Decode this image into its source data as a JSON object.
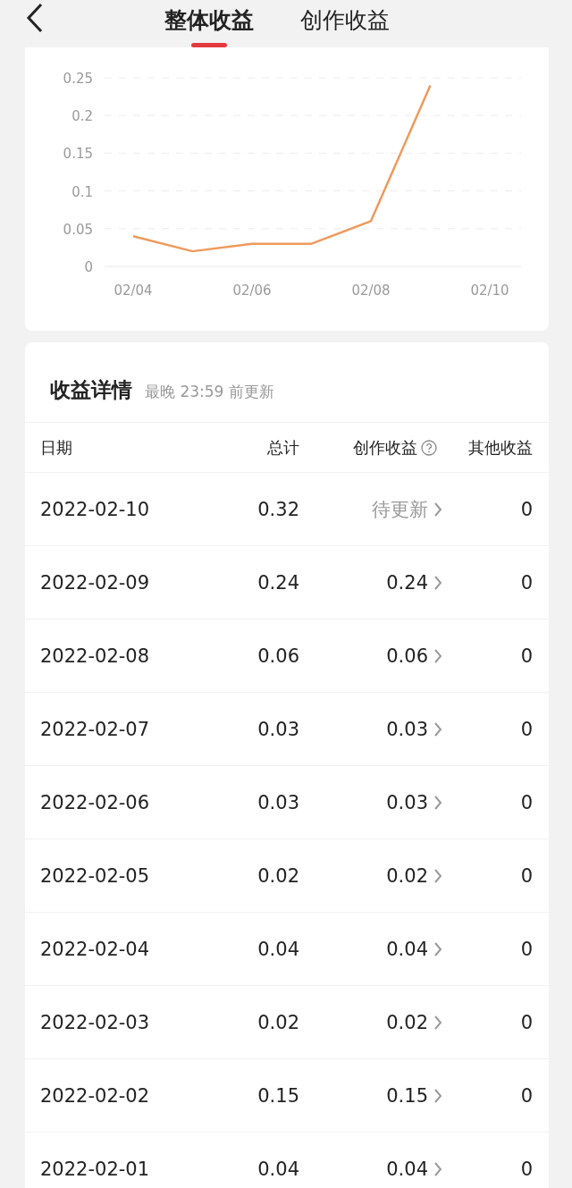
{
  "tabs": [
    {
      "label": "整体收益",
      "selected": true
    },
    {
      "label": "创作收益",
      "selected": false
    }
  ],
  "trend": {
    "chart_data": {
      "type": "line",
      "grid": true,
      "ylim": [
        0,
        0.25
      ],
      "categories": [
        "02/04",
        null,
        "02/06",
        null,
        "02/08",
        null,
        "02/10"
      ],
      "series": [
        {
          "color": "#ee9a5c",
          "values": [
            0.04,
            0.02,
            0.03,
            0.03,
            0.06,
            0.24,
            null
          ]
        }
      ],
      "yticks": [
        {
          "value": 0,
          "label": "0"
        },
        {
          "value": 0.05,
          "label": "0.05"
        },
        {
          "value": 0.1,
          "label": "0.1"
        },
        {
          "value": 0.15,
          "label": "0.15"
        },
        {
          "value": 0.2,
          "label": "0.2"
        },
        {
          "value": 0.25,
          "label": "0.25"
        }
      ]
    }
  },
  "details": {
    "title": "收益详情",
    "note": "最晚 23:59 前更新",
    "columns": [
      "日期",
      "总计",
      "创作收益",
      "其他收益"
    ],
    "rows": [
      {
        "date": "2022-02-10",
        "total": "0.32",
        "creation": "待更新",
        "pending": true,
        "other": "0"
      },
      {
        "date": "2022-02-09",
        "total": "0.24",
        "creation": "0.24",
        "pending": false,
        "other": "0"
      },
      {
        "date": "2022-02-08",
        "total": "0.06",
        "creation": "0.06",
        "pending": false,
        "other": "0"
      },
      {
        "date": "2022-02-07",
        "total": "0.03",
        "creation": "0.03",
        "pending": false,
        "other": "0"
      },
      {
        "date": "2022-02-06",
        "total": "0.03",
        "creation": "0.03",
        "pending": false,
        "other": "0"
      },
      {
        "date": "2022-02-05",
        "total": "0.02",
        "creation": "0.02",
        "pending": false,
        "other": "0"
      },
      {
        "date": "2022-02-04",
        "total": "0.04",
        "creation": "0.04",
        "pending": false,
        "other": "0"
      },
      {
        "date": "2022-02-03",
        "total": "0.02",
        "creation": "0.02",
        "pending": false,
        "other": "0"
      },
      {
        "date": "2022-02-02",
        "total": "0.15",
        "creation": "0.15",
        "pending": false,
        "other": "0"
      },
      {
        "date": "2022-02-01",
        "total": "0.04",
        "creation": "0.04",
        "pending": false,
        "other": "0"
      }
    ]
  }
}
